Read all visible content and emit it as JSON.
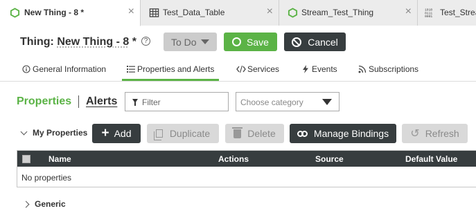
{
  "tabs": [
    {
      "label": "New Thing - 8 *",
      "icon": "hexagon-icon",
      "active": true,
      "close": "×"
    },
    {
      "label": "Test_Data_Table",
      "icon": "table-icon",
      "active": false,
      "close": "×"
    },
    {
      "label": "Stream_Test_Thing",
      "icon": "hexagon-icon",
      "active": false,
      "close": "×"
    },
    {
      "label": "Test_Strea",
      "icon": "binary-icon",
      "active": false
    }
  ],
  "header": {
    "title_prefix": "Thing: ",
    "title_name": "New Thing - 8",
    "title_suffix": " *",
    "help": "?",
    "todo_label": "To Do",
    "save_label": "Save",
    "cancel_label": "Cancel"
  },
  "section_tabs": [
    {
      "label": "General Information",
      "icon": "info-icon"
    },
    {
      "label": "Properties and Alerts",
      "icon": "list-icon",
      "active": true
    },
    {
      "label": "Services",
      "icon": "code-icon"
    },
    {
      "label": "Events",
      "icon": "bolt-icon"
    },
    {
      "label": "Subscriptions",
      "icon": "rss-icon"
    }
  ],
  "properties_panel": {
    "properties_label": "Properties",
    "alerts_label": "Alerts",
    "filter_placeholder": "Filter",
    "category_placeholder": "Choose category",
    "group_label": "My Properties",
    "buttons": {
      "add": "Add",
      "duplicate": "Duplicate",
      "delete": "Delete",
      "manage_bindings": "Manage Bindings",
      "refresh": "Refresh"
    },
    "table": {
      "columns": [
        "Name",
        "Actions",
        "Source",
        "Default Value"
      ],
      "empty_text": "No properties"
    },
    "generic_label": "Generic"
  },
  "colors": {
    "accent_green": "#5bb346",
    "dark": "#373d3f",
    "disabled": "#d9d9d9"
  }
}
